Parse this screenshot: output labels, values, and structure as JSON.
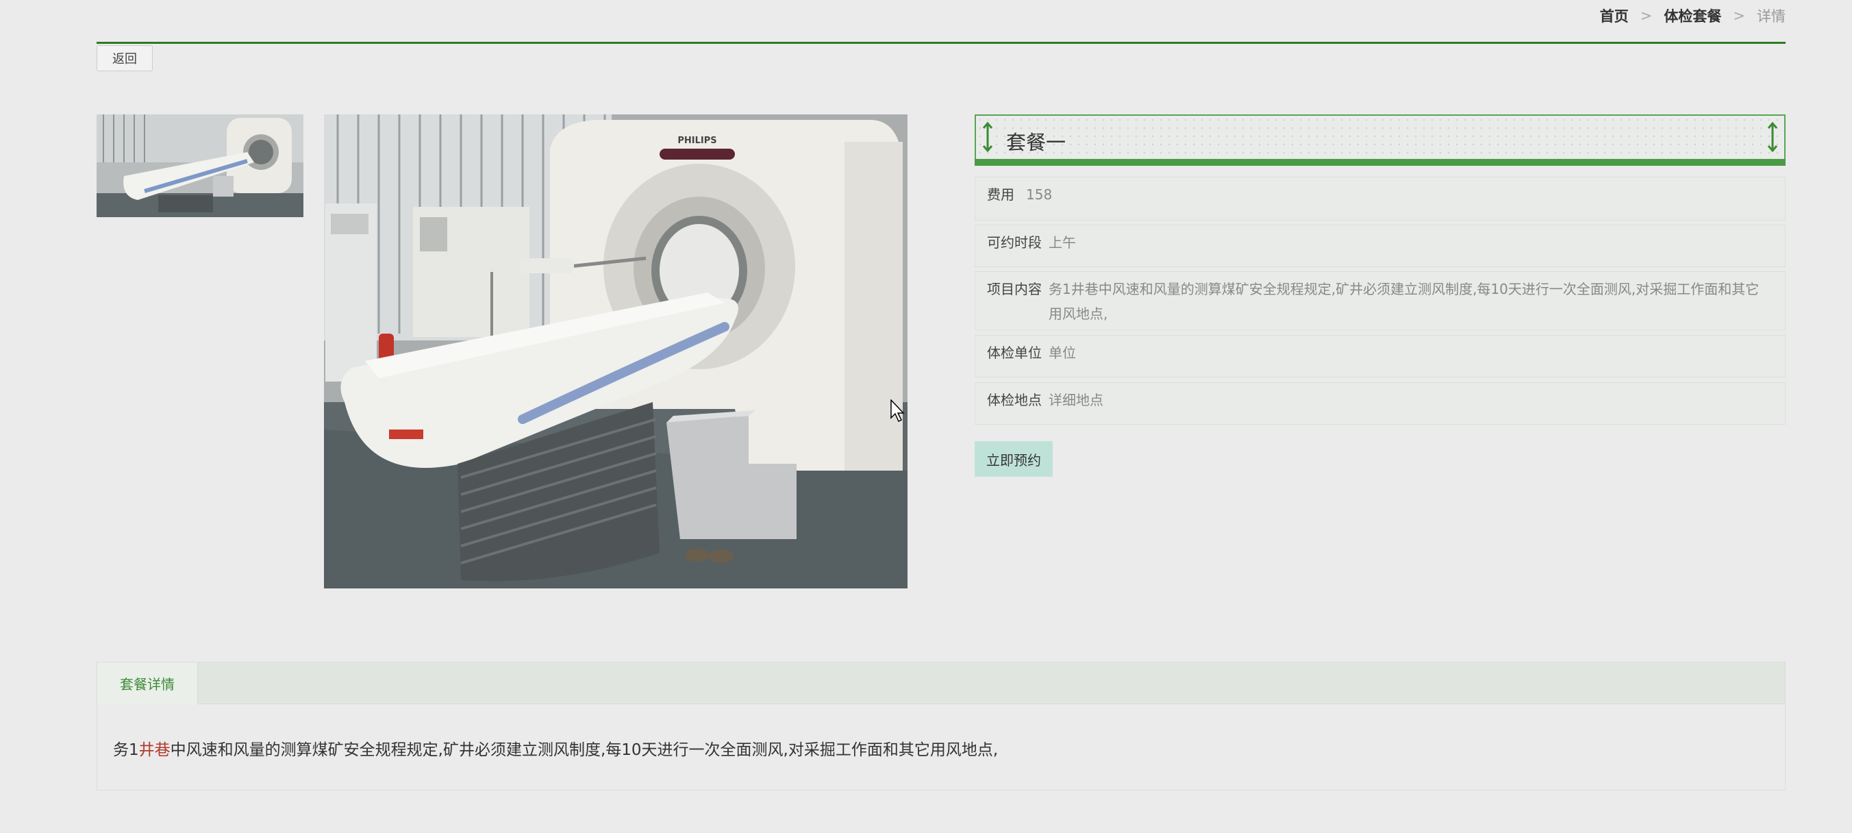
{
  "breadcrumb": {
    "home": "首页",
    "sep1": ">",
    "packages": "体检套餐",
    "sep2": ">",
    "current": "详情"
  },
  "back_label": "返回",
  "package": {
    "name": "套餐一",
    "fields": [
      {
        "label": "费用",
        "value": "158"
      },
      {
        "label": "可约时段",
        "value": "上午"
      },
      {
        "label": "项目内容",
        "value": "务1井巷中风速和风量的测算煤矿安全规程规定,矿井必须建立测风制度,每10天进行一次全面测风,对采掘工作面和其它用风地点,"
      },
      {
        "label": "体检单位",
        "value": "单位"
      },
      {
        "label": "体检地点",
        "value": "详细地点"
      }
    ],
    "book_label": "立即预约"
  },
  "images": {
    "brand_text": "PHILIPS"
  },
  "detail": {
    "tab_label": "套餐详情",
    "content_before": "务1",
    "content_highlight": "井巷",
    "content_after": "中风速和风量的测算煤矿安全规程规定,矿井必须建立测风制度,每10天进行一次全面测风,对采掘工作面和其它用风地点,"
  },
  "colors": {
    "accent_green": "#2f7a25",
    "title_bar_green": "#4b9a45",
    "book_button_bg": "#bfe2d8",
    "highlight_red": "#b23a2a"
  }
}
